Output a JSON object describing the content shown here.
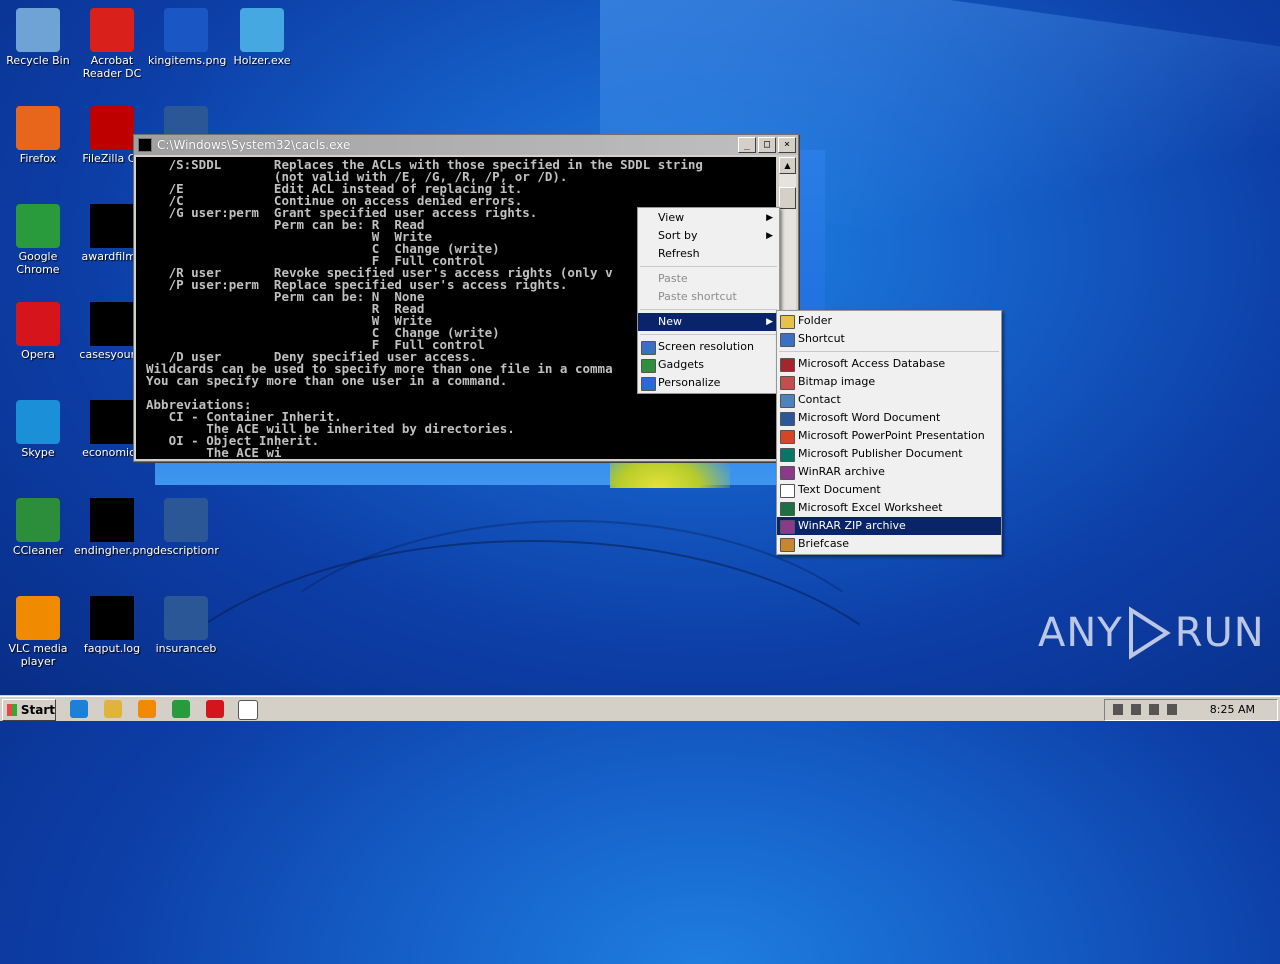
{
  "desktop": {
    "icons": [
      {
        "label": "Recycle Bin",
        "icon": "recycle-bin-icon",
        "color": "#6fa3d6"
      },
      {
        "label": "Acrobat\nReader DC",
        "icon": "acrobat-icon",
        "color": "#d9201b"
      },
      {
        "label": "kingitems.png",
        "icon": "image-file-icon",
        "color": "#1a57c4"
      },
      {
        "label": "Holzer.exe",
        "icon": "exe-icon",
        "color": "#46a8e0"
      },
      {
        "label": "Firefox",
        "icon": "firefox-icon",
        "color": "#e8661c"
      },
      {
        "label": "FileZilla Cli",
        "icon": "filezilla-icon",
        "color": "#bf0000"
      },
      {
        "label": "",
        "icon": "word-document-icon",
        "color": "#2b5797"
      },
      {
        "label": "Google\nChrome",
        "icon": "chrome-icon",
        "color": "#2a9b3c"
      },
      {
        "label": "awardfilm.j",
        "icon": "hidden-file-icon",
        "color": "#000000"
      },
      {
        "label": "Opera",
        "icon": "opera-icon",
        "color": "#d6141c"
      },
      {
        "label": "casesyoung",
        "icon": "hidden-file-icon",
        "color": "#000000"
      },
      {
        "label": "Skype",
        "icon": "skype-icon",
        "color": "#1b8fd8"
      },
      {
        "label": "economica",
        "icon": "hidden-file-icon",
        "color": "#000000"
      },
      {
        "label": "CCleaner",
        "icon": "ccleaner-icon",
        "color": "#2c8d3a"
      },
      {
        "label": "endingher.png",
        "icon": "hidden-file-icon",
        "color": "#000000"
      },
      {
        "label": "descriptionr",
        "icon": "word-document-icon",
        "color": "#2b5797"
      },
      {
        "label": "VLC media\nplayer",
        "icon": "vlc-icon",
        "color": "#f08a00"
      },
      {
        "label": "faqput.log",
        "icon": "hidden-file-icon",
        "color": "#000000"
      },
      {
        "label": "insuranceb",
        "icon": "word-document-icon",
        "color": "#2b5797"
      }
    ]
  },
  "console": {
    "title": "C:\\Windows\\System32\\cacls.exe",
    "min_label": "_",
    "max_label": "□",
    "close_label": "×",
    "text": "   /S:SDDL       Replaces the ACLs with those specified in the SDDL string\n                 (not valid with /E, /G, /R, /P, or /D).\n   /E            Edit ACL instead of replacing it.\n   /C            Continue on access denied errors.\n   /G user:perm  Grant specified user access rights.\n                 Perm can be: R  Read\n                              W  Write\n                              C  Change (write)\n                              F  Full control\n   /R user       Revoke specified user's access rights (only v\n   /P user:perm  Replace specified user's access rights.\n                 Perm can be: N  None\n                              R  Read\n                              W  Write\n                              C  Change (write)\n                              F  Full control\n   /D user       Deny specified user access.\nWildcards can be used to specify more than one file in a comma\nYou can specify more than one user in a command.\n\nAbbreviations:\n   CI - Container Inherit.\n        The ACE will be inherited by directories.\n   OI - Object Inherit.\n        The ACE wi"
  },
  "context_menu": {
    "items": [
      {
        "label": "View"
      },
      {
        "label": "Sort by"
      },
      {
        "label": "Refresh"
      },
      {
        "label": "Paste"
      },
      {
        "label": "Paste shortcut"
      },
      {
        "label": "New"
      },
      {
        "label": "Screen resolution"
      },
      {
        "label": "Gadgets"
      },
      {
        "label": "Personalize"
      }
    ],
    "submenu_arrow": "▶"
  },
  "new_submenu": {
    "items": [
      {
        "label": "Folder",
        "icon": "folder-icon",
        "color": "#e7c24a"
      },
      {
        "label": "Shortcut",
        "icon": "shortcut-icon",
        "color": "#3a6fc4"
      },
      {
        "label": "Microsoft Access Database",
        "icon": "access-icon",
        "color": "#a4262c"
      },
      {
        "label": "Bitmap image",
        "icon": "bitmap-icon",
        "color": "#c0504d"
      },
      {
        "label": "Contact",
        "icon": "contact-icon",
        "color": "#4f81bd"
      },
      {
        "label": "Microsoft Word Document",
        "icon": "word-icon",
        "color": "#2b5797"
      },
      {
        "label": "Microsoft PowerPoint Presentation",
        "icon": "powerpoint-icon",
        "color": "#d24726"
      },
      {
        "label": "Microsoft Publisher Document",
        "icon": "publisher-icon",
        "color": "#077568"
      },
      {
        "label": "WinRAR archive",
        "icon": "winrar-icon",
        "color": "#8a3a8a"
      },
      {
        "label": "Text Document",
        "icon": "text-file-icon",
        "color": "#ffffff"
      },
      {
        "label": "Microsoft Excel Worksheet",
        "icon": "excel-icon",
        "color": "#1d7044"
      },
      {
        "label": "WinRAR ZIP archive",
        "icon": "winrar-zip-icon",
        "color": "#8a3a8a"
      },
      {
        "label": "Briefcase",
        "icon": "briefcase-icon",
        "color": "#c9872d"
      }
    ],
    "highlighted": "WinRAR ZIP archive"
  },
  "taskbar": {
    "start_label": "Start",
    "clock": "8:25 AM",
    "quick_launch": [
      {
        "icon": "ie-icon",
        "color": "#1e7fd6"
      },
      {
        "icon": "explorer-icon",
        "color": "#e0b43c"
      },
      {
        "icon": "media-player-icon",
        "color": "#f08a00"
      },
      {
        "icon": "chrome-icon",
        "color": "#2a9b3c"
      },
      {
        "icon": "opera-icon",
        "color": "#d6141c"
      },
      {
        "icon": "console-icon",
        "color": "#ffffff"
      }
    ]
  },
  "watermark": {
    "left": "ANY",
    "right": "RUN"
  }
}
